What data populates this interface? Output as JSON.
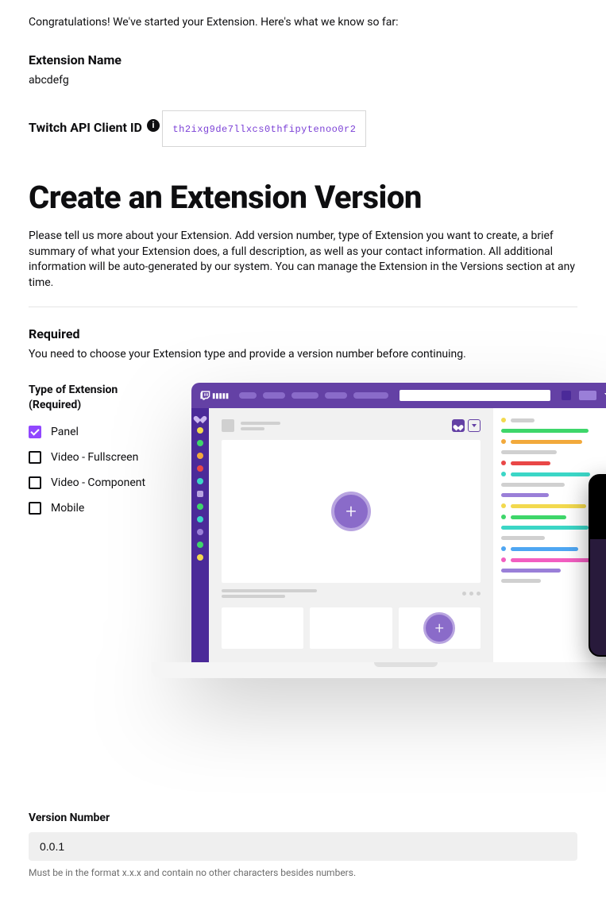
{
  "intro": {
    "congrats": "Congratulations! We've started your Extension. Here's what we know so far:",
    "extension_name_label": "Extension Name",
    "extension_name_value": "abcdefg",
    "client_id_label": "Twitch API Client ID",
    "client_id_value": "th2ixg9de7llxcs0thfipytenoo0r2"
  },
  "heading": "Create an Extension Version",
  "description": "Please tell us more about your Extension. Add version number, type of Extension you want to create, a brief summary of what your Extension does, a full description, as well as your contact information. All additional information will be auto-generated by our system. You can manage the Extension in the Versions section at any time.",
  "required": {
    "heading": "Required",
    "text": "You need to choose your Extension type and provide a version number before continuing."
  },
  "type": {
    "label": "Type of Extension (Required)",
    "options": [
      {
        "label": "Panel",
        "checked": true
      },
      {
        "label": "Video - Fullscreen",
        "checked": false
      },
      {
        "label": "Video - Component",
        "checked": false
      },
      {
        "label": "Mobile",
        "checked": false
      }
    ]
  },
  "version": {
    "label": "Version Number",
    "value": "0.0.1",
    "hint": "Must be in the format x.x.x and contain no other characters besides numbers."
  }
}
